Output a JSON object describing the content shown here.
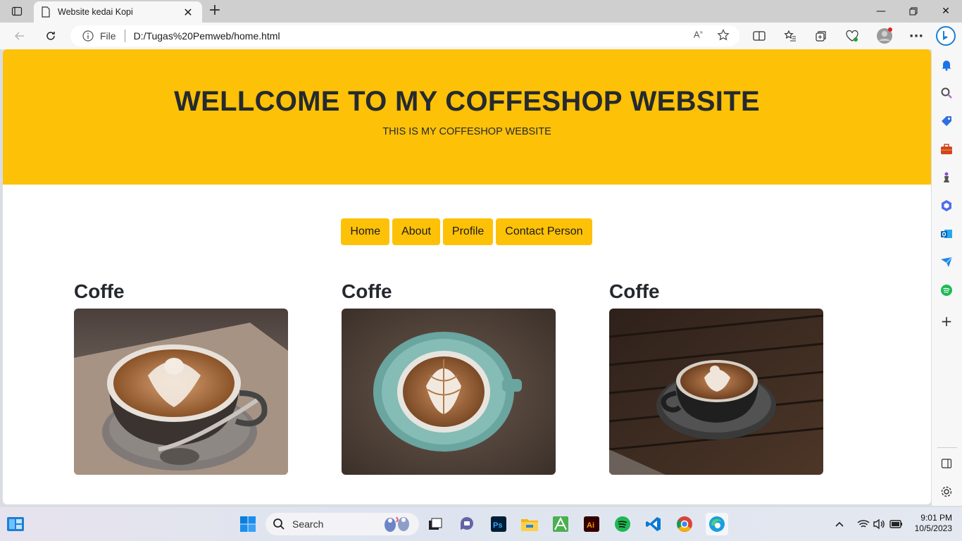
{
  "browser": {
    "tab_title": "Website kedai Kopi",
    "address_scheme": "File",
    "address_url": "D:/Tugas%20Pemweb/home.html"
  },
  "page": {
    "hero_title": "WELLCOME TO MY COFFESHOP WEBSITE",
    "hero_subtitle": "THIS IS MY COFFESHOP WEBSITE",
    "nav": [
      "Home",
      "About",
      "Profile",
      "Contact Person"
    ],
    "cards": [
      {
        "title": "Coffe",
        "image": "latte-art-cup-on-tray"
      },
      {
        "title": "Coffe",
        "image": "latte-art-teal-cup-top-view"
      },
      {
        "title": "Coffe",
        "image": "latte-art-dark-cup-on-wood"
      }
    ],
    "accent_color": "#fdc107"
  },
  "taskbar": {
    "search_placeholder": "Search",
    "time": "9:01 PM",
    "date": "10/5/2023"
  }
}
